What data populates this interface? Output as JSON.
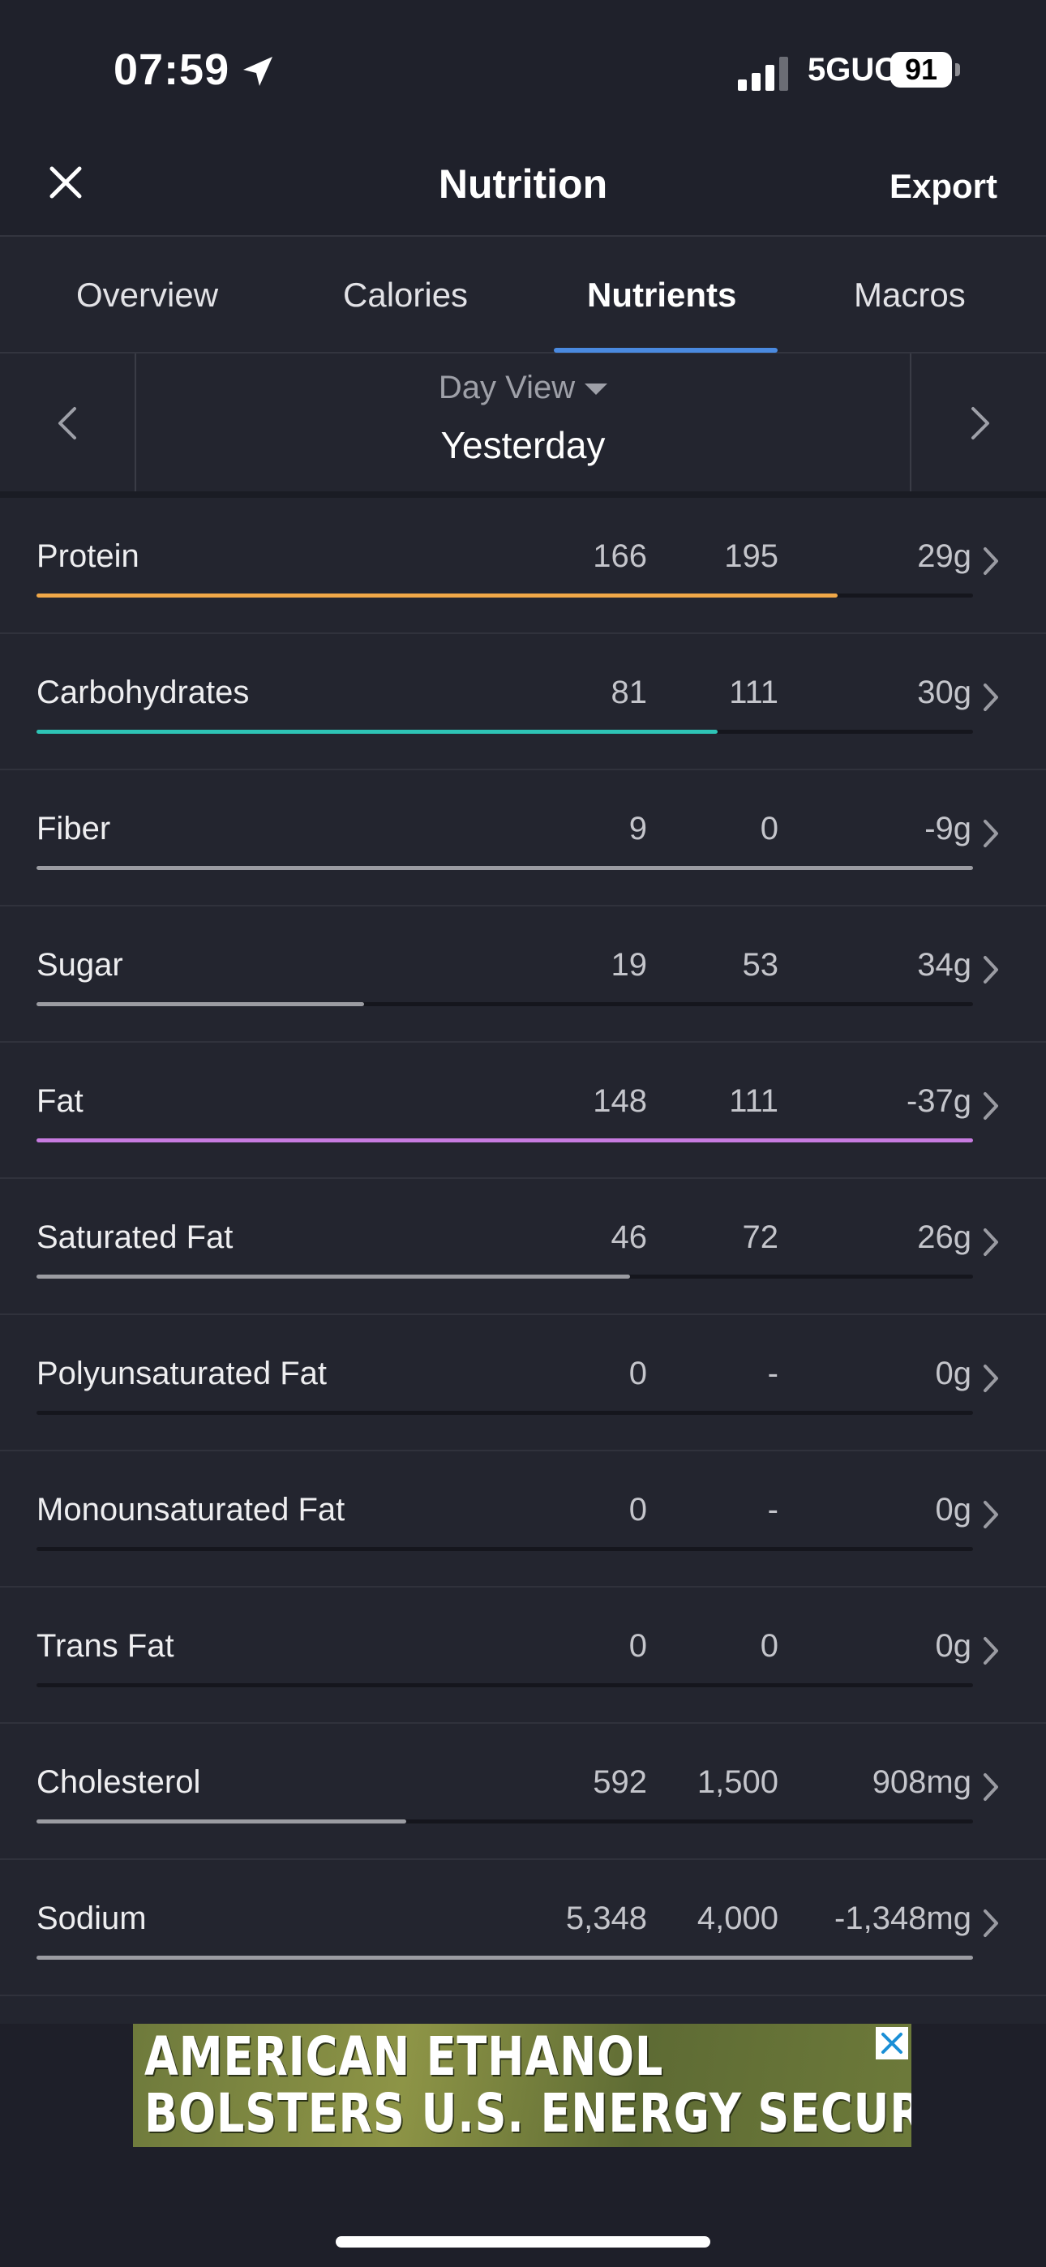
{
  "status_bar": {
    "time": "07:59",
    "network": "5GUC",
    "battery": "91"
  },
  "header": {
    "title": "Nutrition",
    "export_label": "Export"
  },
  "tabs": [
    {
      "label": "Overview",
      "active": false
    },
    {
      "label": "Calories",
      "active": false
    },
    {
      "label": "Nutrients",
      "active": true
    },
    {
      "label": "Macros",
      "active": false
    }
  ],
  "day_nav": {
    "view_label": "Day View",
    "value": "Yesterday"
  },
  "colors": {
    "protein": "#f0a848",
    "carbohydrates": "#2ec4b6",
    "fat": "#c77be0",
    "default_bar": "#9b9ca2",
    "tab_indicator": "#4a8ae0"
  },
  "nutrients": [
    {
      "name": "Protein",
      "total": "166",
      "goal": "195",
      "left": "29g",
      "progress": 0.855,
      "color": "#f0a848"
    },
    {
      "name": "Carbohydrates",
      "total": "81",
      "goal": "111",
      "left": "30g",
      "progress": 0.727,
      "color": "#2ec4b6"
    },
    {
      "name": "Fiber",
      "total": "9",
      "goal": "0",
      "left": "-9g",
      "progress": 1.0,
      "color": "#9b9ca2"
    },
    {
      "name": "Sugar",
      "total": "19",
      "goal": "53",
      "left": "34g",
      "progress": 0.35,
      "color": "#9b9ca2"
    },
    {
      "name": "Fat",
      "total": "148",
      "goal": "111",
      "left": "-37g",
      "progress": 1.0,
      "color": "#c77be0"
    },
    {
      "name": "Saturated Fat",
      "total": "46",
      "goal": "72",
      "left": "26g",
      "progress": 0.634,
      "color": "#9b9ca2"
    },
    {
      "name": "Polyunsaturated Fat",
      "total": "0",
      "goal": "-",
      "left": "0g",
      "progress": 0,
      "color": "#9b9ca2"
    },
    {
      "name": "Monounsaturated Fat",
      "total": "0",
      "goal": "-",
      "left": "0g",
      "progress": 0,
      "color": "#9b9ca2"
    },
    {
      "name": "Trans Fat",
      "total": "0",
      "goal": "0",
      "left": "0g",
      "progress": 0,
      "color": "#9b9ca2"
    },
    {
      "name": "Cholesterol",
      "total": "592",
      "goal": "1,500",
      "left": "908mg",
      "progress": 0.395,
      "color": "#9b9ca2"
    },
    {
      "name": "Sodium",
      "total": "5,348",
      "goal": "4,000",
      "left": "-1,348mg",
      "progress": 1.0,
      "color": "#9b9ca2"
    }
  ],
  "ad": {
    "line1": "AMERICAN ETHANOL",
    "line2": "BOLSTERS U.S. ENERGY SECURITY"
  }
}
